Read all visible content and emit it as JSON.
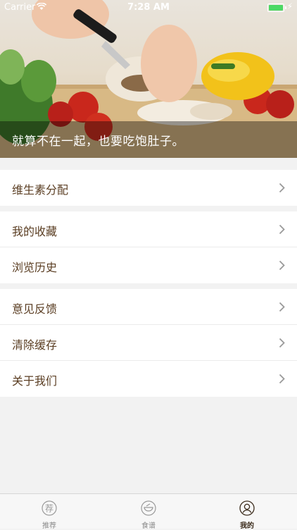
{
  "status_bar": {
    "carrier": "Carrier",
    "time": "7:28 AM"
  },
  "hero": {
    "caption": "就算不在一起，也要吃饱肚子。"
  },
  "menu": {
    "group1": [
      {
        "label": "维生素分配"
      }
    ],
    "group2": [
      {
        "label": "我的收藏"
      },
      {
        "label": "浏览历史"
      }
    ],
    "group3": [
      {
        "label": "意见反馈"
      },
      {
        "label": "清除缓存"
      },
      {
        "label": "关于我们"
      }
    ]
  },
  "tabbar": {
    "tabs": [
      {
        "label": "推荐",
        "icon": "recommend-icon",
        "glyph": "荐"
      },
      {
        "label": "食谱",
        "icon": "recipe-bowl-icon"
      },
      {
        "label": "我的",
        "icon": "profile-icon"
      }
    ],
    "active_index": 2
  },
  "colors": {
    "accent_text": "#5a3d22",
    "battery": "#4cd964",
    "background": "#f2f2f2"
  }
}
